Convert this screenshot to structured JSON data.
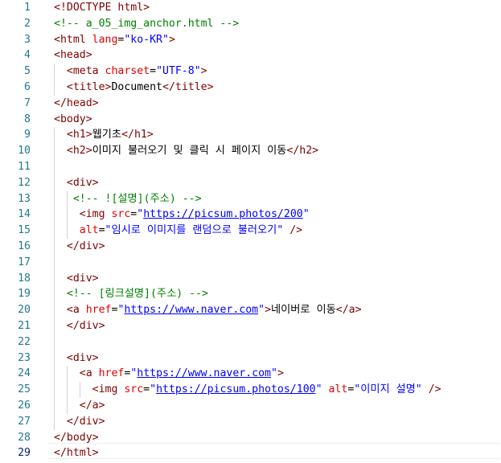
{
  "editor": {
    "active_line": 29,
    "colors": {
      "tag": "#800000",
      "attr": "#e50000",
      "value": "#0000ff",
      "comment": "#008000",
      "text": "#000000",
      "line_number": "#237893"
    },
    "lines": [
      {
        "n": "1",
        "indent": 0,
        "tokens": [
          [
            "tag",
            "<!DOCTYPE html>"
          ]
        ]
      },
      {
        "n": "2",
        "indent": 0,
        "tokens": [
          [
            "com",
            "<!-- a_05_img_anchor.html -->"
          ]
        ]
      },
      {
        "n": "3",
        "indent": 0,
        "tokens": [
          [
            "tag",
            "<html "
          ],
          [
            "attr",
            "lang"
          ],
          [
            "txt",
            "="
          ],
          [
            "val",
            "\"ko-KR\""
          ],
          [
            "tag",
            ">"
          ]
        ]
      },
      {
        "n": "4",
        "indent": 0,
        "tokens": [
          [
            "tag",
            "<head>"
          ]
        ]
      },
      {
        "n": "5",
        "indent": 2,
        "tokens": [
          [
            "tag",
            "<meta "
          ],
          [
            "attr",
            "charset"
          ],
          [
            "txt",
            "="
          ],
          [
            "val",
            "\"UTF-8\""
          ],
          [
            "tag",
            ">"
          ]
        ]
      },
      {
        "n": "6",
        "indent": 2,
        "tokens": [
          [
            "tag",
            "<title>"
          ],
          [
            "txt",
            "Document"
          ],
          [
            "tag",
            "</title>"
          ]
        ]
      },
      {
        "n": "7",
        "indent": 0,
        "tokens": [
          [
            "tag",
            "</head>"
          ]
        ]
      },
      {
        "n": "8",
        "indent": 0,
        "tokens": [
          [
            "tag",
            "<body>"
          ]
        ]
      },
      {
        "n": "9",
        "indent": 2,
        "tokens": [
          [
            "tag",
            "<h1>"
          ],
          [
            "txt",
            "웹기초"
          ],
          [
            "tag",
            "</h1>"
          ]
        ]
      },
      {
        "n": "10",
        "indent": 2,
        "tokens": [
          [
            "tag",
            "<h2>"
          ],
          [
            "txt",
            "이미지 불러오기 및 클릭 시 페이지 이동"
          ],
          [
            "tag",
            "</h2>"
          ]
        ]
      },
      {
        "n": "11",
        "indent": 0,
        "tokens": []
      },
      {
        "n": "12",
        "indent": 2,
        "tokens": [
          [
            "tag",
            "<div>"
          ]
        ]
      },
      {
        "n": "13",
        "indent": 3,
        "tokens": [
          [
            "com",
            "<!-- ![설명](주소) -->"
          ]
        ]
      },
      {
        "n": "14",
        "indent": 4,
        "tokens": [
          [
            "tag",
            "<img "
          ],
          [
            "attr",
            "src"
          ],
          [
            "txt",
            "="
          ],
          [
            "val",
            "\""
          ],
          [
            "link",
            "https://picsum.photos/200"
          ],
          [
            "val",
            "\""
          ]
        ]
      },
      {
        "n": "15",
        "indent": 4,
        "tokens": [
          [
            "attr",
            "alt"
          ],
          [
            "txt",
            "="
          ],
          [
            "val",
            "\"임시로 이미지를 랜덤으로 불러오기\""
          ],
          [
            "txt",
            " "
          ],
          [
            "tag",
            "/>"
          ]
        ]
      },
      {
        "n": "16",
        "indent": 2,
        "tokens": [
          [
            "tag",
            "</div>"
          ]
        ]
      },
      {
        "n": "17",
        "indent": 0,
        "tokens": []
      },
      {
        "n": "18",
        "indent": 2,
        "tokens": [
          [
            "tag",
            "<div>"
          ]
        ]
      },
      {
        "n": "19",
        "indent": 2,
        "tokens": [
          [
            "com",
            "<!-- [링크설명](주소) -->"
          ]
        ]
      },
      {
        "n": "20",
        "indent": 2,
        "tokens": [
          [
            "tag",
            "<a "
          ],
          [
            "attr",
            "href"
          ],
          [
            "txt",
            "="
          ],
          [
            "val",
            "\""
          ],
          [
            "link",
            "https://www.naver.com"
          ],
          [
            "val",
            "\""
          ],
          [
            "tag",
            ">"
          ],
          [
            "txt",
            "네이버로 이동"
          ],
          [
            "tag",
            "</a>"
          ]
        ]
      },
      {
        "n": "21",
        "indent": 2,
        "tokens": [
          [
            "tag",
            "</div>"
          ]
        ]
      },
      {
        "n": "22",
        "indent": 0,
        "tokens": []
      },
      {
        "n": "23",
        "indent": 2,
        "tokens": [
          [
            "tag",
            "<div>"
          ]
        ]
      },
      {
        "n": "24",
        "indent": 4,
        "tokens": [
          [
            "tag",
            "<a "
          ],
          [
            "attr",
            "href"
          ],
          [
            "txt",
            "="
          ],
          [
            "val",
            "\""
          ],
          [
            "link",
            "https://www.naver.com"
          ],
          [
            "val",
            "\""
          ],
          [
            "tag",
            ">"
          ]
        ]
      },
      {
        "n": "25",
        "indent": 6,
        "tokens": [
          [
            "tag",
            "<img "
          ],
          [
            "attr",
            "src"
          ],
          [
            "txt",
            "="
          ],
          [
            "val",
            "\""
          ],
          [
            "link",
            "https://picsum.photos/100"
          ],
          [
            "val",
            "\""
          ],
          [
            "txt",
            " "
          ],
          [
            "attr",
            "alt"
          ],
          [
            "txt",
            "="
          ],
          [
            "val",
            "\"이미지 설명\""
          ],
          [
            "txt",
            " "
          ],
          [
            "tag",
            "/>"
          ]
        ]
      },
      {
        "n": "26",
        "indent": 4,
        "tokens": [
          [
            "tag",
            "</a>"
          ]
        ]
      },
      {
        "n": "27",
        "indent": 2,
        "tokens": [
          [
            "tag",
            "</div>"
          ]
        ]
      },
      {
        "n": "28",
        "indent": 0,
        "tokens": [
          [
            "tag",
            "</body>"
          ]
        ]
      },
      {
        "n": "29",
        "indent": 0,
        "tokens": [
          [
            "tag",
            "</html>"
          ]
        ]
      }
    ]
  }
}
